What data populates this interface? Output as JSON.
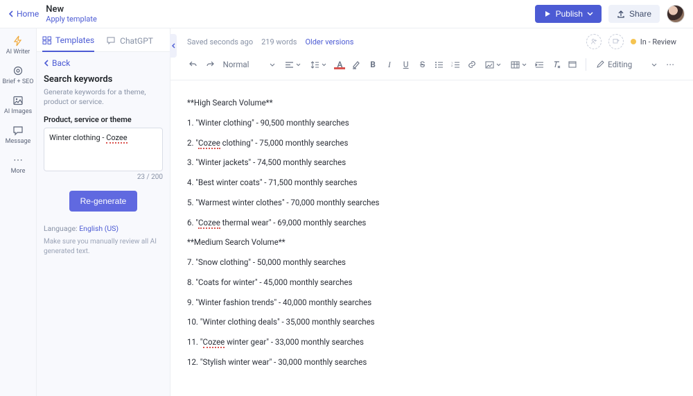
{
  "header": {
    "home": "Home",
    "title": "New",
    "apply": "Apply template",
    "publish": "Publish",
    "share": "Share"
  },
  "rail": [
    {
      "label": "AI Writer"
    },
    {
      "label": "Brief + SEO"
    },
    {
      "label": "AI Images"
    },
    {
      "label": "Message"
    },
    {
      "label": "More"
    }
  ],
  "tabs": {
    "templates": "Templates",
    "chatgpt": "ChatGPT"
  },
  "panel": {
    "back": "Back",
    "title": "Search keywords",
    "desc": "Generate keywords for a theme, product or service.",
    "field_label": "Product, service or theme",
    "input_prefix": "Winter clothing - ",
    "input_underlined": "Cozee",
    "count": "23 / 200",
    "regen": "Re-generate",
    "lang_label": "Language: ",
    "lang_value": "English (US)",
    "warn": "Make sure you manually review all AI generated text."
  },
  "editor": {
    "meta": {
      "saved": "Saved seconds ago",
      "words": "219 words",
      "older": "Older versions"
    },
    "status": "In - Review",
    "style_select": "Normal",
    "mode": "Editing"
  },
  "doc": {
    "s1": "**High Search Volume**",
    "l1a": "1. \"Winter clothing\" - 90,500 monthly searches",
    "l2a": "2. \"",
    "l2b": "Cozee",
    "l2c": " clothing\" - 75,000 monthly searches",
    "l3": "3. \"Winter jackets\" - 74,500 monthly searches",
    "l4": "4. \"Best winter coats\" - 71,500 monthly searches",
    "l5": "5. \"Warmest winter clothes\" - 70,000 monthly searches",
    "l6a": "6. \"",
    "l6b": "Cozee",
    "l6c": " thermal wear\" - 69,000 monthly searches",
    "s2": "**Medium Search Volume**",
    "l7": "7. \"Snow clothing\" - 50,000 monthly searches",
    "l8": "8. \"Coats for winter\" - 45,000 monthly searches",
    "l9": "9. \"Winter fashion trends\" - 40,000 monthly searches",
    "l10": "10.  \"Winter clothing deals\" - 35,000 monthly searches",
    "l11a": "11. \"",
    "l11b": "Cozee",
    "l11c": " winter gear\" - 33,000 monthly searches",
    "l12": "12. \"Stylish winter wear\" - 30,000 monthly searches"
  }
}
